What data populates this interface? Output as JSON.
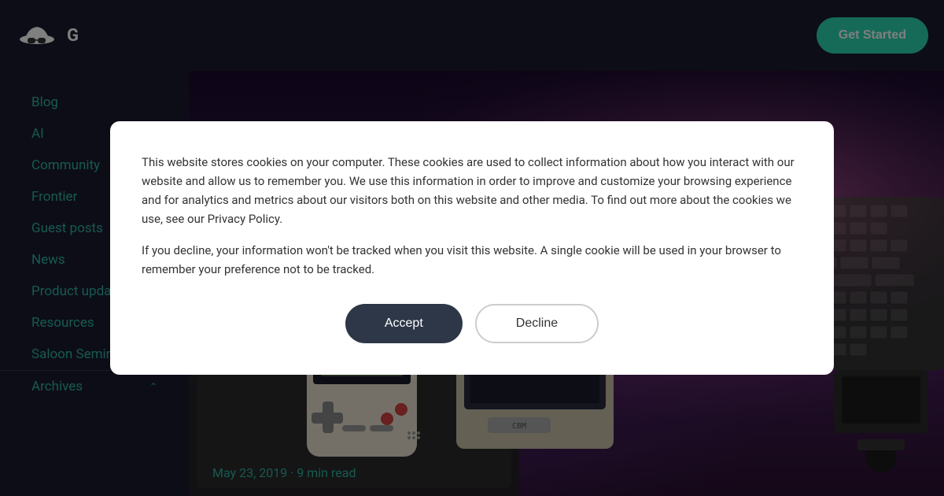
{
  "nav": {
    "logo_text": "G",
    "get_started_label": "Get Started"
  },
  "sidebar": {
    "items": [
      {
        "label": "Blog",
        "id": "blog"
      },
      {
        "label": "AI",
        "id": "ai"
      },
      {
        "label": "Community",
        "id": "community"
      },
      {
        "label": "Frontier",
        "id": "frontier"
      },
      {
        "label": "Guest posts",
        "id": "guest-posts"
      },
      {
        "label": "News",
        "id": "news"
      },
      {
        "label": "Product updates",
        "id": "product-updates"
      },
      {
        "label": "Resources",
        "id": "resources"
      },
      {
        "label": "Saloon Seminars",
        "id": "saloon-seminars"
      }
    ],
    "archives_label": "Archives"
  },
  "hero": {
    "date": "May 23, 2019",
    "read_time": "9 min read",
    "date_separator": "·"
  },
  "cookie": {
    "body1": "This website stores cookies on your computer. These cookies are used to collect information about how you interact with our website and allow us to remember you. We use this information in order to improve and customize your browsing experience and for analytics and metrics about our visitors both on this website and other media. To find out more about the cookies we use, see our Privacy Policy.",
    "body2": "If you decline, your information won't be tracked when you visit this website. A single cookie will be used in your browser to remember your preference not to be tracked.",
    "accept_label": "Accept",
    "decline_label": "Decline"
  },
  "colors": {
    "accent": "#2cb5a0",
    "sidebar_bg": "#1a1a2e",
    "get_started_btn": "#2dd4b0",
    "modal_bg": "#ffffff",
    "accept_btn": "#2d3748"
  }
}
